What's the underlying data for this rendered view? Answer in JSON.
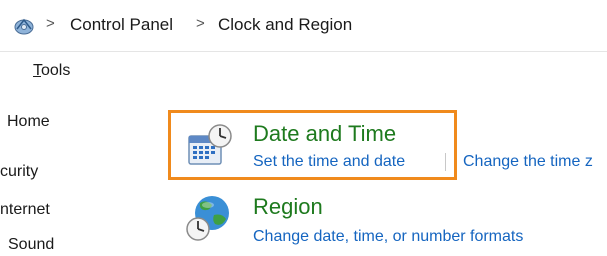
{
  "breadcrumb": {
    "icon": "control-panel-icon",
    "items": [
      "Control Panel",
      "Clock and Region"
    ],
    "separator": ">"
  },
  "menu": {
    "tools_accel": "T",
    "tools_rest": "ools"
  },
  "nav": {
    "items": [
      "Home",
      "curity",
      "nternet",
      "Sound"
    ]
  },
  "categories": [
    {
      "icon": "calendar-clock-icon",
      "title": "Date and Time",
      "links": [
        "Set the time and date",
        "Change the time z"
      ],
      "highlighted": true
    },
    {
      "icon": "globe-clock-icon",
      "title": "Region",
      "links": [
        "Change date, time, or number formats"
      ]
    }
  ],
  "colors": {
    "category_title": "#1e7a1e",
    "link": "#1565c0",
    "highlight_border": "#f08a1c"
  }
}
